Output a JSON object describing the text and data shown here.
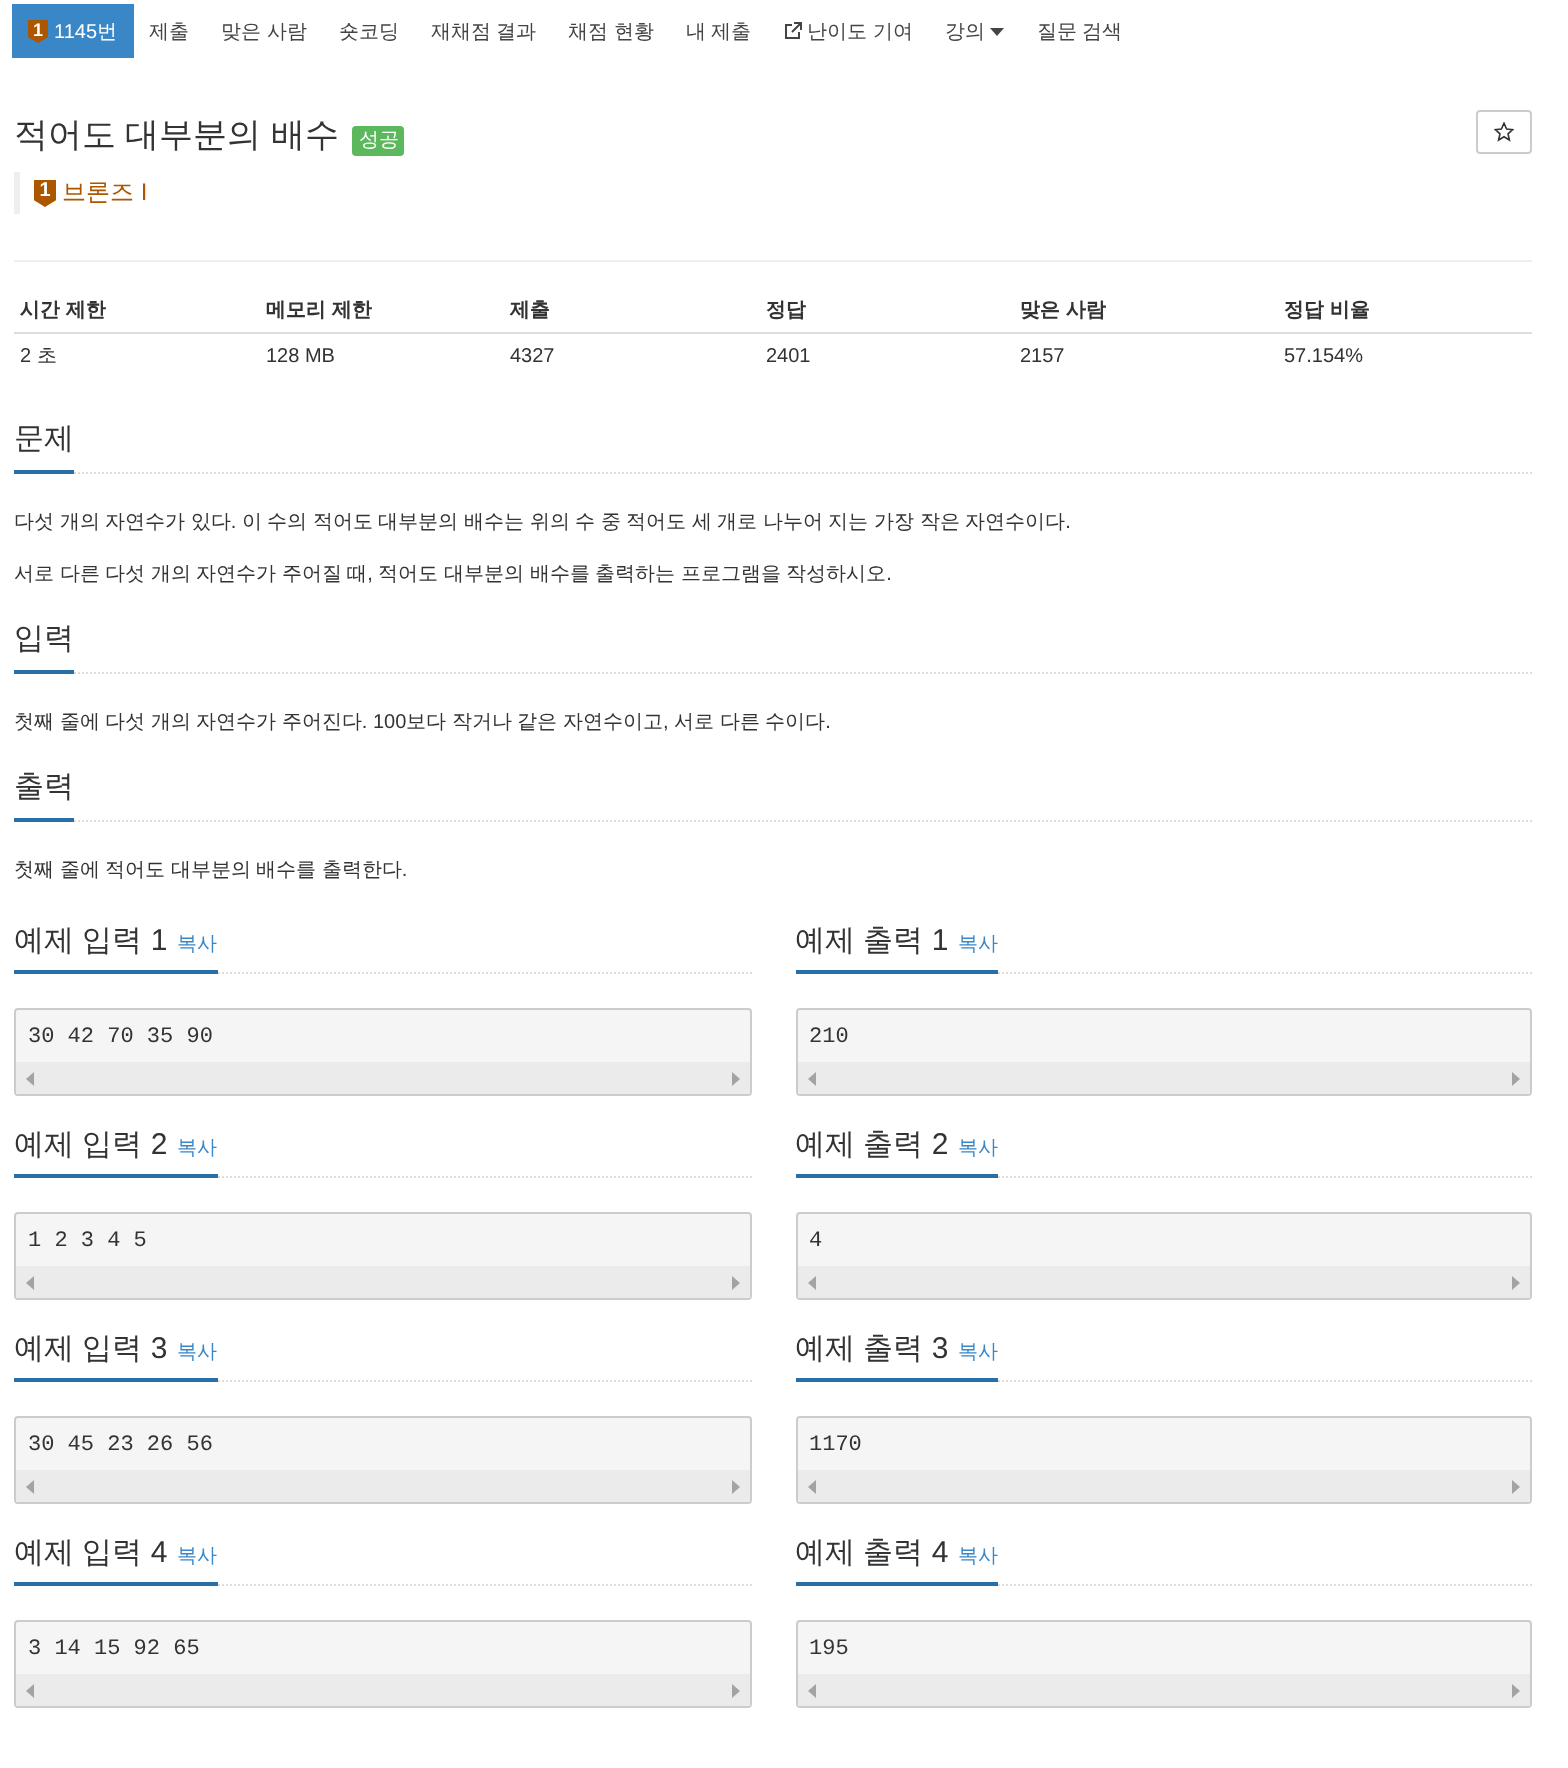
{
  "nav": {
    "tabs": [
      {
        "kind": "problem",
        "tier_numeral": "1",
        "label": "1145번",
        "selected": true
      },
      {
        "kind": "link",
        "label": "제출",
        "selected": false
      },
      {
        "kind": "link",
        "label": "맞은 사람",
        "selected": false
      },
      {
        "kind": "link",
        "label": "숏코딩",
        "selected": false
      },
      {
        "kind": "link",
        "label": "재채점 결과",
        "selected": false
      },
      {
        "kind": "link",
        "label": "채점 현황",
        "selected": false
      },
      {
        "kind": "link",
        "label": "내 제출",
        "selected": false
      },
      {
        "kind": "external",
        "label": "난이도 기여",
        "selected": false
      },
      {
        "kind": "dropdown",
        "label": "강의",
        "selected": false
      },
      {
        "kind": "link",
        "label": "질문 검색",
        "selected": false
      }
    ]
  },
  "problem": {
    "title": "적어도 대부분의 배수",
    "status_badge": "성공",
    "tier": {
      "numeral": "1",
      "label": "브론즈 I"
    }
  },
  "info_table": {
    "columns": [
      "시간 제한",
      "메모리 제한",
      "제출",
      "정답",
      "맞은 사람",
      "정답 비율"
    ],
    "rows": [
      [
        "2 초",
        "128 MB",
        "4327",
        "2401",
        "2157",
        "57.154%"
      ]
    ]
  },
  "sections": [
    {
      "title": "문제",
      "paragraphs": [
        "다섯 개의 자연수가 있다. 이 수의 적어도 대부분의 배수는 위의 수 중 적어도 세 개로 나누어 지는 가장 작은 자연수이다.",
        "서로 다른 다섯 개의 자연수가 주어질 때, 적어도 대부분의 배수를 출력하는 프로그램을 작성하시오."
      ]
    },
    {
      "title": "입력",
      "paragraphs": [
        "첫째 줄에 다섯 개의 자연수가 주어진다. 100보다 작거나 같은 자연수이고, 서로 다른 수이다."
      ]
    },
    {
      "title": "출력",
      "paragraphs": [
        "첫째 줄에 적어도 대부분의 배수를 출력한다."
      ]
    }
  ],
  "samples": [
    {
      "input": {
        "title": "예제 입력 1",
        "copy_label": "복사",
        "text": "30 42 70 35 90"
      },
      "output": {
        "title": "예제 출력 1",
        "copy_label": "복사",
        "text": "210"
      }
    },
    {
      "input": {
        "title": "예제 입력 2",
        "copy_label": "복사",
        "text": "1 2 3 4 5"
      },
      "output": {
        "title": "예제 출력 2",
        "copy_label": "복사",
        "text": "4"
      }
    },
    {
      "input": {
        "title": "예제 입력 3",
        "copy_label": "복사",
        "text": "30 45 23 26 56"
      },
      "output": {
        "title": "예제 출력 3",
        "copy_label": "복사",
        "text": "1170"
      }
    },
    {
      "input": {
        "title": "예제 입력 4",
        "copy_label": "복사",
        "text": "3 14 15 92 65"
      },
      "output": {
        "title": "예제 출력 4",
        "copy_label": "복사",
        "text": "195"
      }
    }
  ]
}
